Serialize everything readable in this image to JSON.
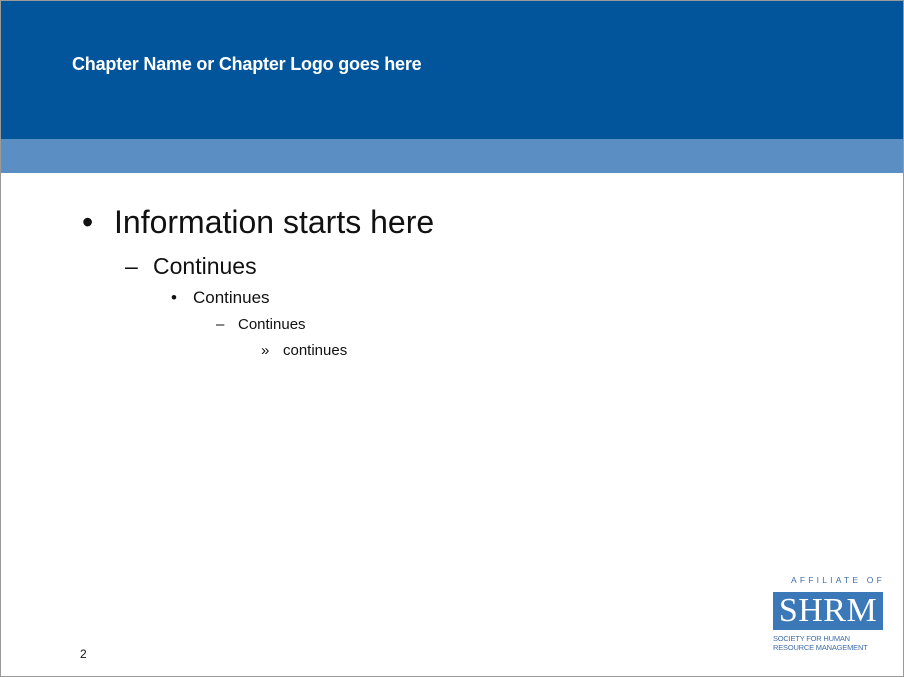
{
  "header": {
    "title": "Chapter Name or Chapter Logo goes here"
  },
  "bullets": [
    {
      "marker": "•",
      "text": "Information starts here"
    },
    {
      "marker": "–",
      "text": "Continues"
    },
    {
      "marker": "•",
      "text": "Continues"
    },
    {
      "marker": "–",
      "text": "Continues"
    },
    {
      "marker": "»",
      "text": "continues"
    }
  ],
  "footer": {
    "page_number": "2"
  },
  "logo": {
    "affiliate": "AFFILIATE OF",
    "wordmark": "SHRM",
    "subtitle_line1": "Society for Human",
    "subtitle_line2": "Resource Management"
  },
  "colors": {
    "header_dark": "#03559b",
    "header_light": "#5b8ec3",
    "logo_blue": "#3b78b8"
  }
}
